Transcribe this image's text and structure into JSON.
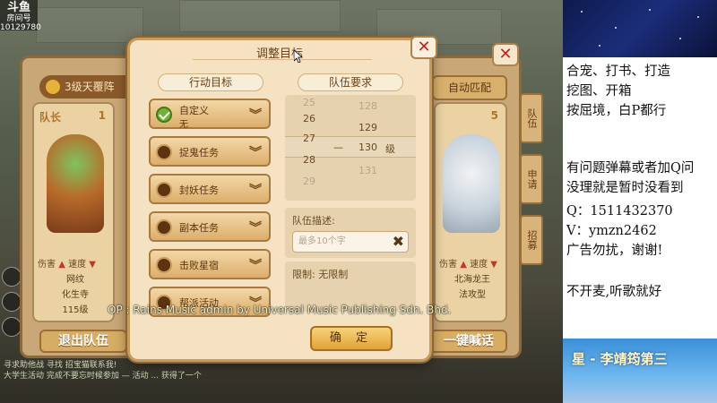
{
  "stream": {
    "logo_text": "斗鱼",
    "room_label": "房间号",
    "room_id": "10129780"
  },
  "team_panel": {
    "formation_label": "3级天覆阵",
    "auto_match_label": "自动匹配",
    "leader_label": "队长",
    "slot1_num": "1",
    "slot5_num": "5",
    "member1": {
      "stat1": "伤害",
      "stat2": "速度",
      "name": "网纹",
      "school": "化生寺",
      "level": "115级"
    },
    "member5": {
      "stat1": "伤害",
      "stat2": "速度",
      "name": "北海龙王",
      "school": "法攻型"
    },
    "side_tabs": [
      "队伍",
      "申请",
      "招募"
    ],
    "leave_team_label": "退出队伍",
    "shout_label": "一键喊话"
  },
  "chat": {
    "line1": "寻求助他战 寻找 招宝猫联系我!",
    "line2": "大学生活动 完成不要忘时候参加 — 活动 ... 获得了一个"
  },
  "dialog": {
    "title": "调整目标",
    "goals_header": "行动目标",
    "team_req_header": "队伍要求",
    "goals": [
      {
        "label": "自定义",
        "sub": "无",
        "checked": true
      },
      {
        "label": "捉鬼任务",
        "checked": false
      },
      {
        "label": "封妖任务",
        "checked": false
      },
      {
        "label": "副本任务",
        "checked": false
      },
      {
        "label": "击败星宿",
        "checked": false
      },
      {
        "label": "帮派活动",
        "checked": false
      }
    ],
    "level_left": [
      "25",
      "26",
      "27",
      "28",
      "29"
    ],
    "level_right": [
      "128",
      "129",
      "130",
      "131"
    ],
    "level_selected": "130",
    "level_unit": "级",
    "level_dash": "—",
    "desc_label": "队伍描述:",
    "desc_placeholder": "最多10个字",
    "limit_label": "限制: 无限制",
    "confirm_label": "确 定"
  },
  "copyright": "OP : Rains Music admin by Universal Music Publishing Sdn. Bhd.",
  "overlay": {
    "notes": [
      "合宠、打书、打造",
      "挖图、开箱",
      "按屈境，白P都行",
      "",
      "有问题弹幕或者加Q问",
      "没理就是暂时没看到",
      "Q：1511432370",
      "V：ymzn2462",
      "广告勿扰，谢谢!",
      "",
      "不开麦,听歌就好"
    ],
    "song": "星 - 李靖筠第三"
  },
  "colors": {
    "accent_gold": "#e0a238",
    "close_red": "#c2251e",
    "check_green": "#6fb335"
  }
}
